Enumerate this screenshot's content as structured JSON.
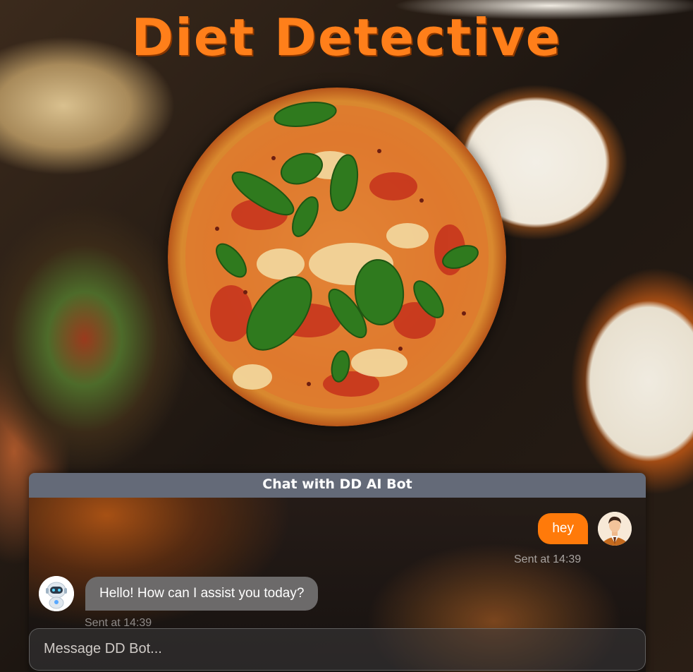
{
  "app": {
    "title": "Diet Detective",
    "accent_color": "#ff7f1a"
  },
  "hero": {
    "icon": "pizza-image"
  },
  "chat": {
    "header": "Chat with DD AI Bot",
    "messages": [
      {
        "sender": "user",
        "text": "hey",
        "time": "Sent at 14:39",
        "avatar": "user-avatar-icon"
      },
      {
        "sender": "bot",
        "text": "Hello! How can I assist you today?",
        "time": "Sent at 14:39",
        "avatar": "robot-avatar-icon"
      }
    ],
    "input": {
      "placeholder": "Message DD Bot...",
      "value": ""
    },
    "colors": {
      "user_bubble": "#ff7a0a",
      "bot_bubble": "#6c6a6a",
      "header": "#646a78"
    }
  }
}
